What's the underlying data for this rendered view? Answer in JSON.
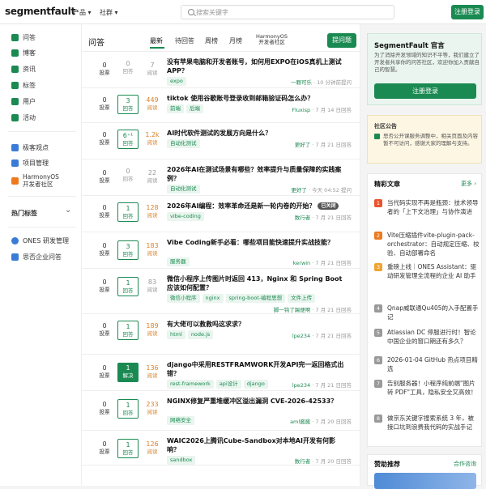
{
  "header": {
    "logo": "segmentfault",
    "nav": [
      {
        "label": "产品 ▾"
      },
      {
        "label": "社群 ▾"
      }
    ],
    "search_placeholder": "搜索关键字",
    "signup_label": "注册登录"
  },
  "sidebar": {
    "items": [
      {
        "label": "问答"
      },
      {
        "label": "博客"
      },
      {
        "label": "资讯"
      },
      {
        "label": "标签"
      },
      {
        "label": "用户"
      },
      {
        "label": "活动"
      }
    ],
    "items2": [
      {
        "label": "极客观点"
      },
      {
        "label": "项目管理"
      },
      {
        "label": "HarmonyOS"
      },
      {
        "label": "开发者社区"
      }
    ],
    "hot_heading": "热门标签",
    "hot_chevron": "⌄",
    "items3": [
      {
        "label": "ONES 研发管理"
      },
      {
        "label": "思否企业问答"
      }
    ]
  },
  "main": {
    "title": "问答",
    "tabs": [
      {
        "label": "最新"
      },
      {
        "label": "待回答"
      },
      {
        "label": "周榜"
      },
      {
        "label": "月榜"
      }
    ],
    "harmony_tab": [
      "HarmonyOS",
      "开发者社区"
    ],
    "ask_label": "提问题",
    "questions": [
      {
        "votes": "0",
        "vlabel": "投票",
        "answers": "0",
        "alabel": "回答",
        "views": "7",
        "wlabel": "阅读",
        "title": "没有苹果电脑和开发者账号，如何用EXPO在iOS真机上测试APP？",
        "tags": [
          "expo"
        ],
        "user": "一颗可乐",
        "time": " · 10 分钟前提问"
      },
      {
        "votes": "0",
        "vlabel": "投票",
        "answers": "3",
        "alabel": "回答",
        "views": "449",
        "wlabel": "阅读",
        "title": "tiktok 使用谷歌账号登录收到邮箱验证码怎么办？",
        "tags": [
          "前端",
          "后端"
        ],
        "user": "Fluxisp",
        "time": " · 7 月 14 日回答"
      },
      {
        "votes": "0",
        "vlabel": "投票",
        "answers": "6⁺¹",
        "alabel": "回答",
        "views": "1.2k",
        "wlabel": "阅读",
        "title": "AI时代软件测试的发展方向是什么？",
        "tags": [
          "自动化测试"
        ],
        "user": "更好了",
        "time": " · 7 月 21 日回答"
      },
      {
        "votes": "0",
        "vlabel": "投票",
        "answers": "0",
        "alabel": "回答",
        "views": "22",
        "wlabel": "阅读",
        "title": "2026年AI在测试场景有哪些？效率提升与质量保障的实践案例？",
        "tags": [
          "自动化测试"
        ],
        "user": "更好了",
        "time": " · 今天 04:52 提问"
      },
      {
        "votes": "0",
        "vlabel": "投票",
        "answers": "1",
        "alabel": "回答",
        "views": "128",
        "wlabel": "阅读",
        "title": "2026年AI编程：效率革命还是新一轮内卷的开始？",
        "hot": "已关闭",
        "tags": [
          "vibe-coding"
        ],
        "user": "数行者",
        "time": " · 7 月 21 日回答"
      },
      {
        "votes": "0",
        "vlabel": "投票",
        "answers": "3",
        "alabel": "回答",
        "views": "183",
        "wlabel": "阅读",
        "title": "Vibe Coding新手必看：哪些项目能快速提升实战技能？",
        "tags": [
          "服务器"
        ],
        "user": "kerwin",
        "time": " · 7 月 21 日回答"
      },
      {
        "votes": "0",
        "vlabel": "投票",
        "answers": "1",
        "alabel": "回答",
        "views": "83",
        "wlabel": "阅读",
        "title": "微信小程序上传图片时返回 413，Nginx 和 Spring Boot 应该如何配置？",
        "tags": [
          "微信小程序",
          "nginx",
          "spring-boot-编程思想",
          "文件上传"
        ],
        "user": "脚一钩了踢便啊",
        "time": " · 7 月 21 日回答"
      },
      {
        "votes": "0",
        "vlabel": "投票",
        "answers": "1",
        "alabel": "回答",
        "views": "189",
        "wlabel": "阅读",
        "title": "有大佬可以救救吗这求求？",
        "tags": [
          "html",
          "node.js"
        ],
        "user": "lpe234",
        "time": " · 7 月 21 日回答"
      },
      {
        "votes": "0",
        "vlabel": "投票",
        "answers": "1",
        "alabel": "解决",
        "views": "136",
        "wlabel": "阅读",
        "title": "django中采用RESTFRAMWORK开发API完一返回格式出错？",
        "tags": [
          "rest-framework",
          "api设计",
          "django"
        ],
        "user": "lpe234",
        "time": " · 7 月 21 日回答"
      },
      {
        "votes": "0",
        "vlabel": "投票",
        "answers": "1",
        "alabel": "回答",
        "views": "233",
        "wlabel": "阅读",
        "title": "NGINX修复严重堆缓冲区溢出漏洞 CVE-2026-42533？",
        "tags": [
          "网络安全"
        ],
        "user": "aml酱酱",
        "time": " · 7 月 20 日回答"
      },
      {
        "votes": "0",
        "vlabel": "投票",
        "answers": "1",
        "alabel": "回答",
        "views": "126",
        "wlabel": "阅读",
        "title": "WAIC2026上腾讯Cube-Sandbox对本地AI开发有何影响？",
        "tags": [
          "sandbox"
        ],
        "user": "数行者",
        "time": " · 7 月 20 日回答"
      }
    ]
  },
  "rail": {
    "sf_title": "SegmentFault 官言",
    "sf_desc": "为了消除开发领域的知识不平等，我们建立了开发者共享你的问答社区，欢迎你加入贡献自己的智慧。",
    "sf_btn": "注册登录",
    "notice_title": "社区公告",
    "notice_text": "思否公开课服务调整中，相关页面及内容暂不可访问，感谢大家的理解与支持。",
    "featured_title": "精彩文章",
    "featured_more": "更多 ›",
    "featured": [
      {
        "n": "1",
        "color": "#e8542f",
        "t": "当代码实现不再是瓶颈：技术领导者的「上下文治理」与协作演进"
      },
      {
        "n": "2",
        "color": "#ee7a1e",
        "t": "Vite压缩插件vite-plugin-pack-orchestrator：自动规定压缩、校验、自动部署命名"
      },
      {
        "n": "3",
        "color": "#f0a330",
        "t": "重磅上线｜ONES Assistant：驱动研发管理全流程的企业 AI 助手"
      },
      {
        "n": "4",
        "color": "#999999",
        "t": "Qnap威联通Qu405的入手配置手记"
      },
      {
        "n": "5",
        "color": "#999999",
        "t": "Atlassian DC 停服进行时！智论中国企业的窗口期还有多久？"
      },
      {
        "n": "6",
        "color": "#999999",
        "t": "2026-01-04 GitHub 热点项目精选"
      },
      {
        "n": "7",
        "color": "#999999",
        "t": "告别服务器！小程序纯前端\"图片转 PDF\"工具，隐私安全又高效！"
      },
      {
        "n": "8",
        "color": "#999999",
        "t": "做京东关键字搜索系统 3 年，被接口坑到浪费我代码的实战手记"
      }
    ],
    "sponsor_title": "赞助推荐",
    "sponsor_more": "合作咨询"
  }
}
